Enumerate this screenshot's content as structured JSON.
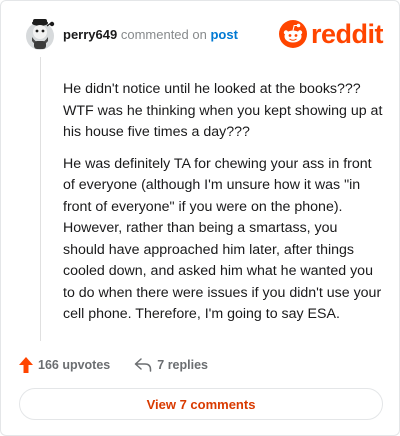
{
  "comment": {
    "username": "perry649",
    "commented_on_text": "commented on",
    "post_link_text": "post",
    "body_paragraphs": [
      "He didn't notice until he looked at the books??? WTF was he thinking when you kept showing up at his house five times a day???",
      "He was definitely TA for chewing your ass in front of everyone (although I'm unsure how it was \"in front of everyone\" if you were on the phone). However, rather than being a smartass, you should have approached him later, after things cooled down, and asked him what he wanted you to do when there were issues if you didn't use your cell phone. Therefore, I'm going to say ESA."
    ]
  },
  "brand": {
    "name": "reddit",
    "color": "#ff4500",
    "icon": "reddit-snoo-icon"
  },
  "actions": {
    "upvotes_label": "166 upvotes",
    "upvote_icon": "upvote-arrow-icon",
    "upvote_color": "#ff4500",
    "replies_label": "7 replies",
    "reply_icon": "reply-arrow-icon"
  },
  "view_comments_label": "View 7 comments"
}
